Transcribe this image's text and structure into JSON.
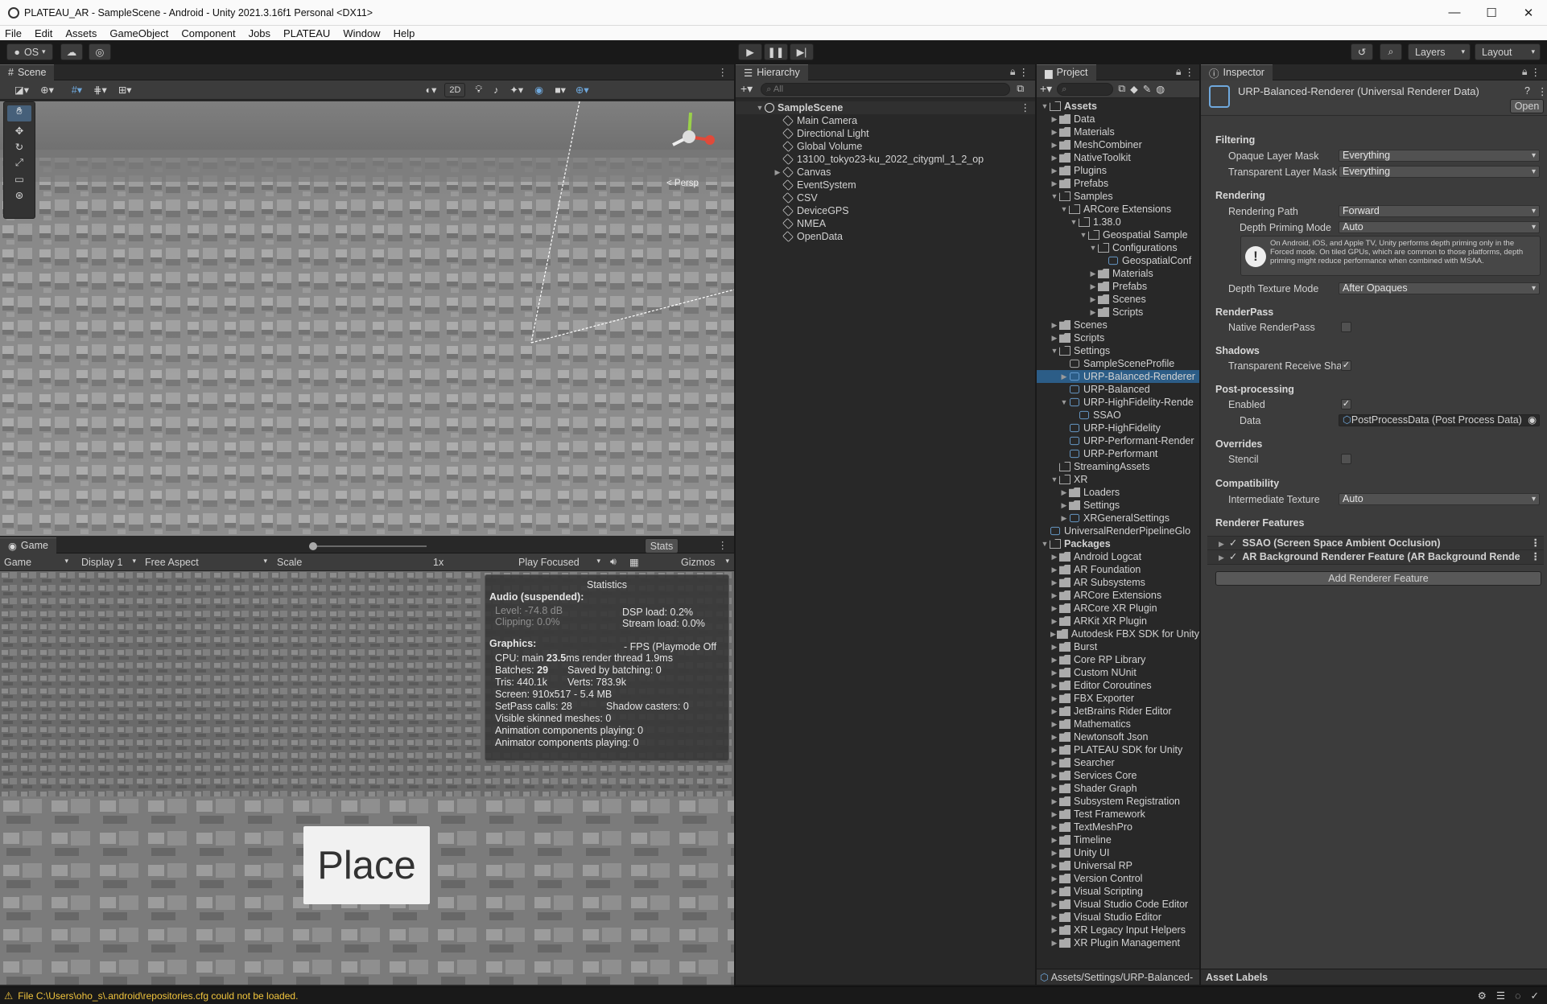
{
  "window": {
    "title": "PLATEAU_AR - SampleScene - Android - Unity 2021.3.16f1 Personal <DX11>",
    "controls": [
      "—",
      "☐",
      "✕"
    ]
  },
  "menu": [
    "File",
    "Edit",
    "Assets",
    "GameObject",
    "Component",
    "Jobs",
    "PLATEAU",
    "Window",
    "Help"
  ],
  "toolbar": {
    "account": "OS",
    "layers": "Layers",
    "layout": "Layout"
  },
  "scene": {
    "tab": "Scene",
    "mode2d": "2D",
    "persp": "< Persp"
  },
  "game": {
    "tab": "Game",
    "view": "Game",
    "display": "Display 1",
    "aspect": "Free Aspect",
    "scale_label": "Scale",
    "scale_value": "1x",
    "play_focused": "Play Focused",
    "stats": "Stats",
    "gizmos": "Gizmos",
    "place_button": "Place",
    "statistics": {
      "title": "Statistics",
      "audio_head": "Audio (suspended):",
      "level": "Level: -74.8 dB",
      "clipping": "Clipping: 0.0%",
      "dsp": "DSP load: 0.2%",
      "stream": "Stream load: 0.0%",
      "graphics_head": "Graphics:",
      "fps": "- FPS (Playmode Off",
      "cpu_pre": "CPU: main ",
      "cpu_main": "23.5",
      "cpu_post": "ms  render thread 1.9ms",
      "batches_pre": "Batches: ",
      "batches": "29",
      "saved": "Saved by batching: 0",
      "tris": "Tris: 440.1k",
      "verts": "Verts: 783.9k",
      "screen": "Screen: 910x517 - 5.4 MB",
      "setpass": "SetPass calls: 28",
      "shadow": "Shadow casters: 0",
      "skinned": "Visible skinned meshes: 0",
      "anim": "Animation components playing: 0",
      "animator": "Animator components playing: 0"
    }
  },
  "hierarchy": {
    "tab": "Hierarchy",
    "search": "All",
    "scene": "SampleScene",
    "items": [
      "Main Camera",
      "Directional Light",
      "Global Volume",
      "13100_tokyo23-ku_2022_citygml_1_2_op",
      "Canvas",
      "EventSystem",
      "CSV",
      "DeviceGPS",
      "NMEA",
      "OpenData"
    ]
  },
  "project": {
    "tab": "Project",
    "footer": "Assets/Settings/URP-Balanced-",
    "assets_root": "Assets",
    "packages_root": "Packages",
    "assets": [
      "Data",
      "Materials",
      "MeshCombiner",
      "NativeToolkit",
      "Plugins",
      "Prefabs",
      "Samples",
      "ARCore Extensions",
      "1.38.0",
      "Geospatial Sample",
      "Configurations",
      "GeospatialConf",
      "Materials",
      "Prefabs",
      "Scenes",
      "Scripts",
      "Scenes",
      "Scripts",
      "Settings",
      "SampleSceneProfile",
      "URP-Balanced-Renderer",
      "URP-Balanced",
      "URP-HighFidelity-Rende",
      "SSAO",
      "URP-HighFidelity",
      "URP-Performant-Render",
      "URP-Performant",
      "StreamingAssets",
      "XR",
      "Loaders",
      "Settings",
      "XRGeneralSettings",
      "UniversalRenderPipelineGlo"
    ],
    "packages": [
      "Android Logcat",
      "AR Foundation",
      "AR Subsystems",
      "ARCore Extensions",
      "ARCore XR Plugin",
      "ARKit XR Plugin",
      "Autodesk FBX SDK for Unity",
      "Burst",
      "Core RP Library",
      "Custom NUnit",
      "Editor Coroutines",
      "FBX Exporter",
      "JetBrains Rider Editor",
      "Mathematics",
      "Newtonsoft Json",
      "PLATEAU SDK for Unity",
      "Searcher",
      "Services Core",
      "Shader Graph",
      "Subsystem Registration",
      "Test Framework",
      "TextMeshPro",
      "Timeline",
      "Unity UI",
      "Universal RP",
      "Version Control",
      "Visual Scripting",
      "Visual Studio Code Editor",
      "Visual Studio Editor",
      "XR Legacy Input Helpers",
      "XR Plugin Management"
    ]
  },
  "inspector": {
    "tab": "Inspector",
    "title": "URP-Balanced-Renderer (Universal Renderer Data)",
    "open": "Open",
    "filtering": "Filtering",
    "opaque_label": "Opaque Layer Mask",
    "opaque": "Everything",
    "transparent_label": "Transparent Layer Mask",
    "transparent": "Everything",
    "rendering": "Rendering",
    "path_label": "Rendering Path",
    "path": "Forward",
    "depth_label": "Depth Priming Mode",
    "depth": "Auto",
    "help": "On Android, iOS, and Apple TV, Unity performs depth priming only in the Forced mode. On tiled GPUs, which are common to those platforms, depth priming might reduce performance when combined with MSAA.",
    "depthtex_label": "Depth Texture Mode",
    "depthtex": "After Opaques",
    "renderpass": "RenderPass",
    "native_label": "Native RenderPass",
    "shadows": "Shadows",
    "trs_label": "Transparent Receive Sha",
    "post": "Post-processing",
    "enabled_label": "Enabled",
    "data_label": "Data",
    "data": "PostProcessData (Post Process Data)",
    "overrides": "Overrides",
    "stencil_label": "Stencil",
    "compat": "Compatibility",
    "inter_label": "Intermediate Texture",
    "inter": "Auto",
    "features": "Renderer Features",
    "feature1": "SSAO (Screen Space Ambient Occlusion)",
    "feature2": "AR Background Renderer Feature (AR Background Rende",
    "add": "Add Renderer Feature",
    "asset_labels": "Asset Labels"
  },
  "status": {
    "message": "File C:\\Users\\oho_s\\.android\\repositories.cfg could not be loaded."
  }
}
